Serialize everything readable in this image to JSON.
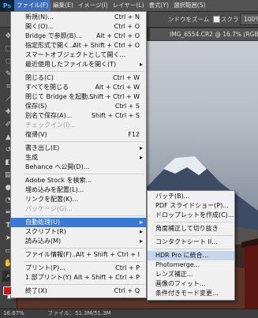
{
  "app": {
    "logo": "Ps",
    "menubar": [
      "ファイル(F)",
      "編集(E)",
      "イメージ(I)",
      "レイヤー(L)",
      "書式(Y)",
      "選択範囲(S)"
    ],
    "active_menu_index": 0
  },
  "options": {
    "fit_window": "ンドウをズーム",
    "scrubby_zoom": "スクラブズーム",
    "zoom_100": "100%"
  },
  "document": {
    "tab_title": "IMG_6554.CR2 @ 16.7% (RGB/8*)"
  },
  "status": {
    "zoom": "16.67%",
    "file_info": "ファイル：51.3M/51.3M"
  },
  "file_menu": {
    "items": [
      {
        "label": "新規(N)...",
        "shortcut": "Ctrl + N"
      },
      {
        "label": "開く(O)...",
        "shortcut": "Ctrl + O"
      },
      {
        "label": "Bridge で参照(B)...",
        "shortcut": "Alt + Ctrl + O"
      },
      {
        "label": "指定形式で開く...",
        "shortcut": "Alt + Shift + Ctrl + O"
      },
      {
        "label": "スマートオブジェクトとして開く...",
        "shortcut": ""
      },
      {
        "label": "最近使用したファイルを開く(T)",
        "shortcut": "▸"
      },
      {
        "label": "閉じる(C)",
        "shortcut": "Ctrl + W"
      },
      {
        "label": "すべてを閉じる",
        "shortcut": "Alt + Ctrl + W"
      },
      {
        "label": "閉じて Bridge を起動...",
        "shortcut": "Shift + Ctrl + W"
      },
      {
        "label": "保存(S)",
        "shortcut": "Ctrl + S"
      },
      {
        "label": "別名で保存(A)...",
        "shortcut": "Shift + Ctrl + S"
      },
      {
        "label": "チェックイン(I)...",
        "shortcut": ""
      },
      {
        "label": "復帰(V)",
        "shortcut": "F12"
      },
      {
        "label": "書き出し(E)",
        "shortcut": "▸"
      },
      {
        "label": "生成",
        "shortcut": "▸"
      },
      {
        "label": "Behance へ公開(D)...",
        "shortcut": ""
      },
      {
        "label": "Adobe Stock を検索...",
        "shortcut": ""
      },
      {
        "label": "埋め込みを配置(L)...",
        "shortcut": ""
      },
      {
        "label": "リンクを配置(K)...",
        "shortcut": ""
      },
      {
        "label": "パッケージ(G)...",
        "shortcut": ""
      },
      {
        "label": "自動処理(U)",
        "shortcut": "▸"
      },
      {
        "label": "スクリプト(R)",
        "shortcut": "▸"
      },
      {
        "label": "読み込み(M)",
        "shortcut": "▸"
      },
      {
        "label": "ファイル情報(F)...",
        "shortcut": "Alt + Shift + Ctrl + I"
      },
      {
        "label": "プリント(P)...",
        "shortcut": "Ctrl + P"
      },
      {
        "label": "1 部プリント(Y)",
        "shortcut": "Alt + Shift + Ctrl + P"
      },
      {
        "label": "終了(X)",
        "shortcut": "Ctrl + Q"
      }
    ]
  },
  "automate_menu": {
    "items": [
      {
        "label": "バッチ(B)..."
      },
      {
        "label": "PDF スライドショー(P)..."
      },
      {
        "label": "ドロップレットを作成(C)..."
      },
      {
        "label": "角度補正して切り抜き"
      },
      {
        "label": "コンタクトシート II..."
      },
      {
        "label": "HDR Pro に統合..."
      },
      {
        "label": "Photomerge..."
      },
      {
        "label": "レンズ補正..."
      },
      {
        "label": "画像のフィット..."
      },
      {
        "label": "条件付きモード変更..."
      }
    ]
  },
  "colors": {
    "highlight": "#3979d6",
    "foreground_swatch": "#d0121b",
    "background_swatch": "#ffffff"
  }
}
